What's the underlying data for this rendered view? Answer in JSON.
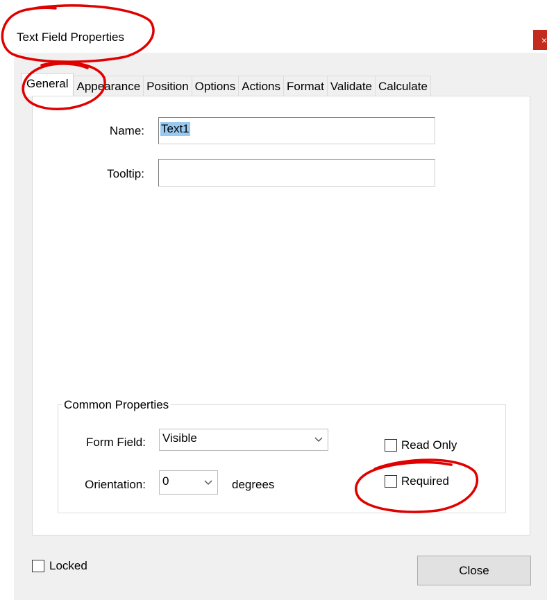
{
  "window": {
    "title": "Text Field Properties",
    "close_glyph": "×"
  },
  "tabs": [
    {
      "label": "General",
      "active": true
    },
    {
      "label": "Appearance"
    },
    {
      "label": "Position"
    },
    {
      "label": "Options"
    },
    {
      "label": "Actions"
    },
    {
      "label": "Format"
    },
    {
      "label": "Validate"
    },
    {
      "label": "Calculate"
    }
  ],
  "general": {
    "name_label": "Name:",
    "name_value": "Text1",
    "tooltip_label": "Tooltip:",
    "tooltip_value": ""
  },
  "common": {
    "legend": "Common Properties",
    "form_field_label": "Form Field:",
    "form_field_value": "Visible",
    "orientation_label": "Orientation:",
    "orientation_value": "0",
    "degrees_label": "degrees",
    "read_only_label": "Read Only",
    "read_only_checked": false,
    "required_label": "Required",
    "required_checked": false
  },
  "footer": {
    "locked_label": "Locked",
    "locked_checked": false,
    "close_label": "Close"
  },
  "colors": {
    "annotation": "#e00000",
    "selection": "#99c9ef",
    "close_x_bg": "#c42b1c"
  }
}
